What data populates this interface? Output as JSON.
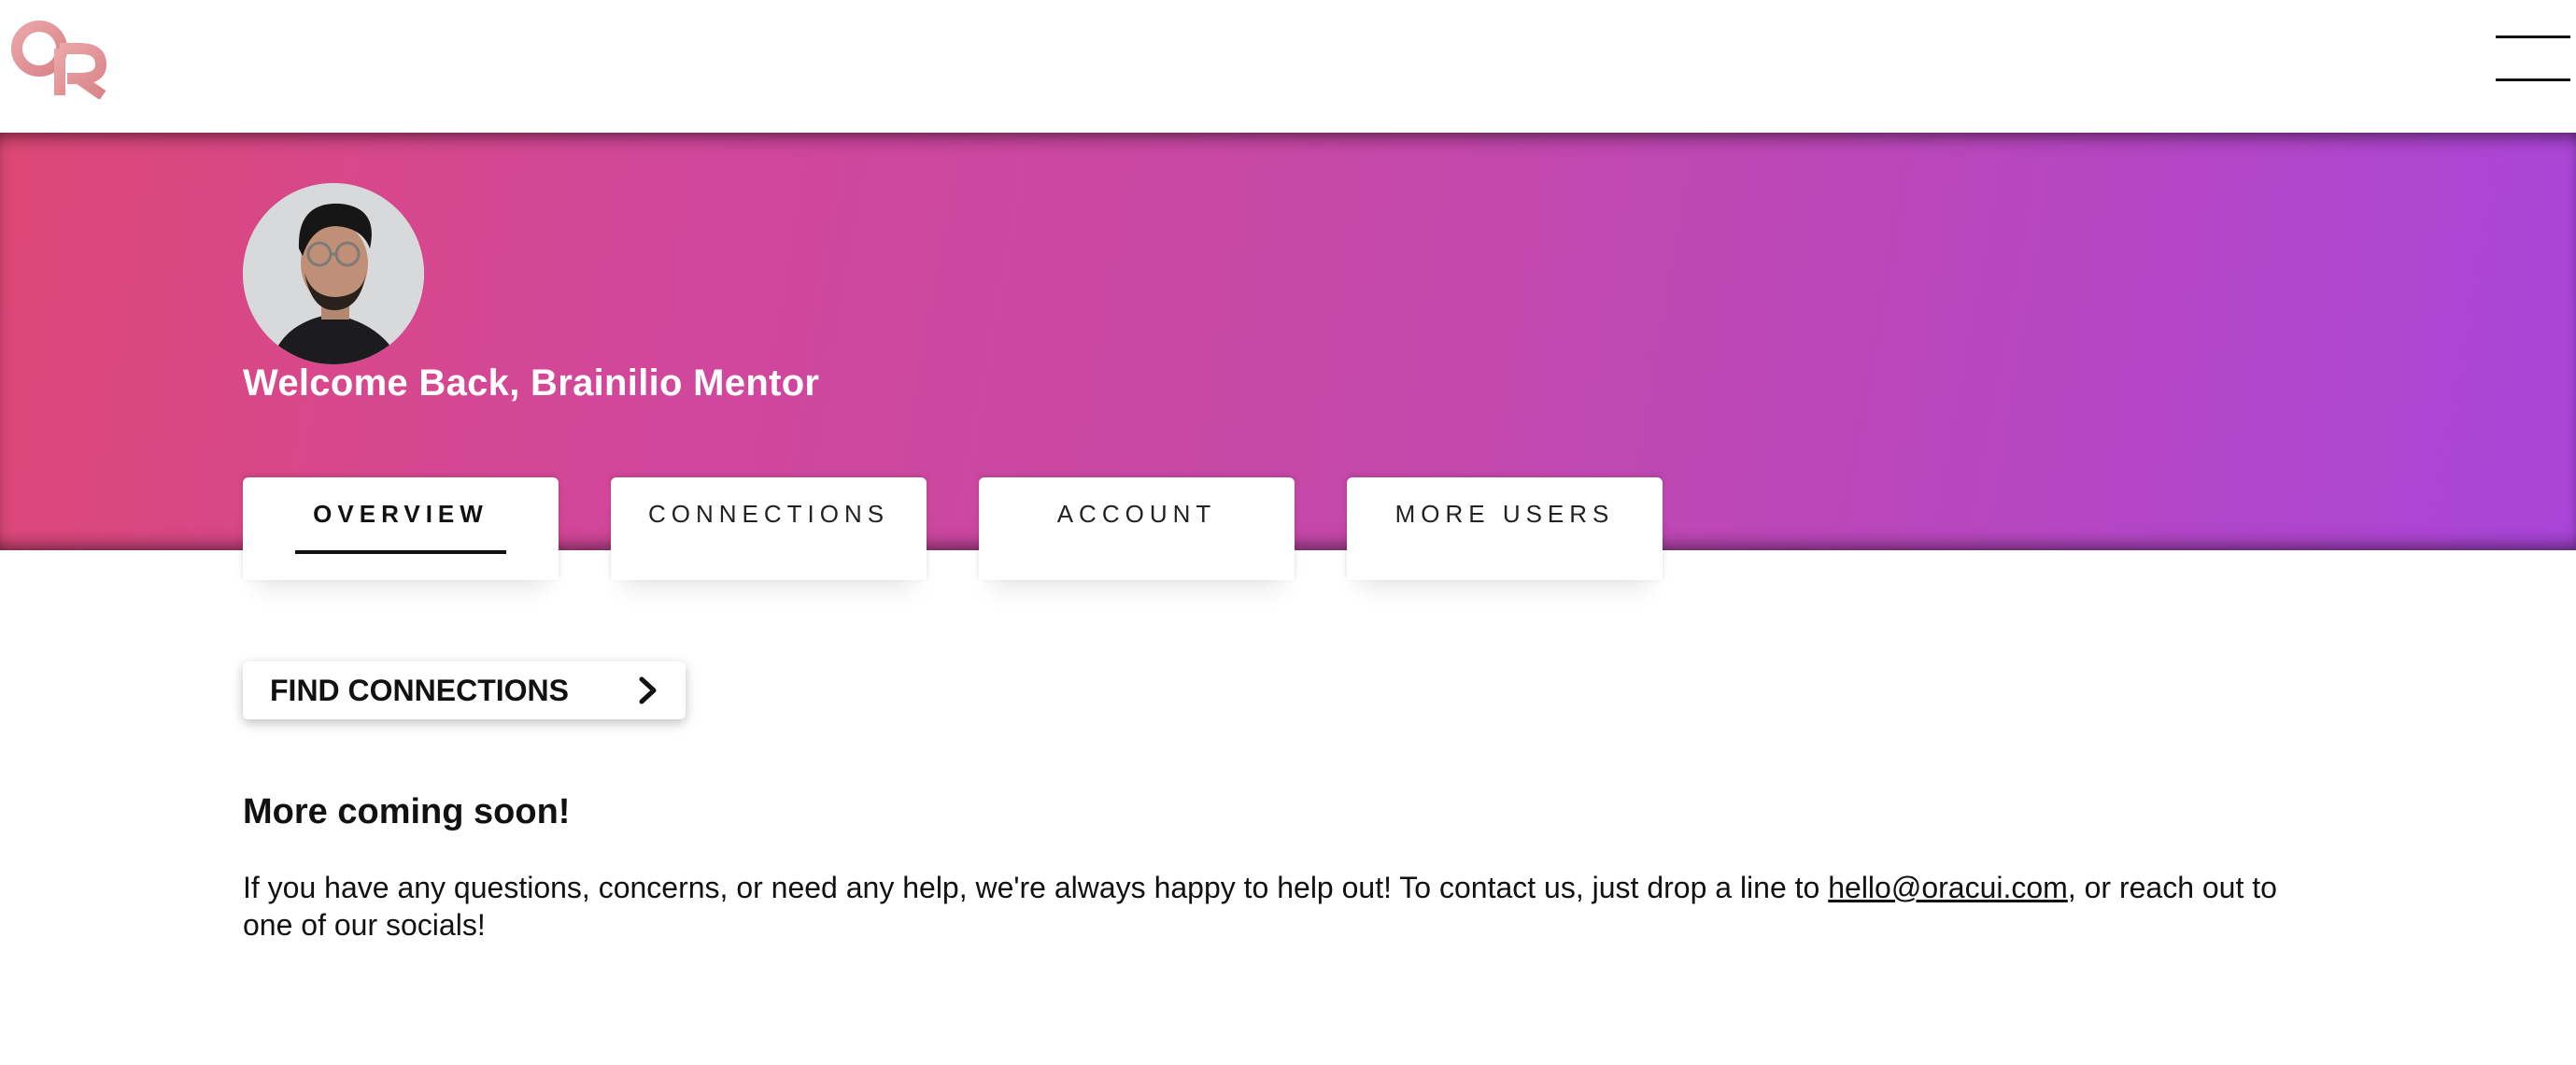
{
  "header": {
    "logo_text": "OR",
    "menu_icon": "hamburger-icon"
  },
  "colors": {
    "hero_gradient_start": "#de4877",
    "hero_gradient_end": "#a945d9",
    "logo_pink": "#e5979b",
    "text": "#111111"
  },
  "hero": {
    "avatar_icon": "user-avatar",
    "welcome": "Welcome Back, Brainilio Mentor"
  },
  "tabs": [
    {
      "label": "OVERVIEW",
      "active": true
    },
    {
      "label": "CONNECTIONS",
      "active": false
    },
    {
      "label": "ACCOUNT",
      "active": false
    },
    {
      "label": "MORE USERS",
      "active": false
    }
  ],
  "main": {
    "find_connections_label": "FIND CONNECTIONS",
    "chevron_icon": "chevron-right-icon",
    "coming_soon": "More coming soon!",
    "contact_before": "If you have any questions, concerns, or need any help, we're always happy to help out! To contact us, just drop a line to ",
    "contact_email": "hello@oracui.com",
    "contact_after": ", or reach out to one of our socials!"
  }
}
